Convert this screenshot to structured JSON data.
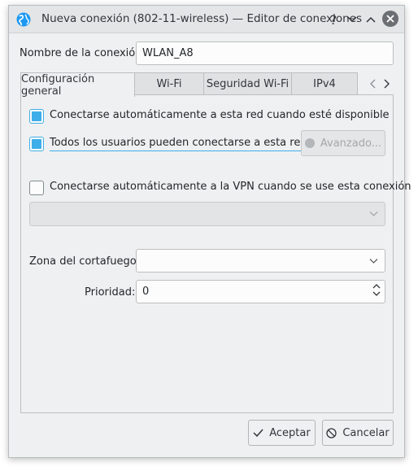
{
  "window": {
    "title": "Nueva conexión (802-11-wireless) — Editor de conexiones",
    "help_glyph": "?"
  },
  "form": {
    "connection_name_label": "Nombre de la conexión:",
    "connection_name_value": "WLAN_A8"
  },
  "tabs": [
    {
      "label": "Configuración general",
      "active": true
    },
    {
      "label": "Wi-Fi",
      "active": false
    },
    {
      "label": "Seguridad Wi-Fi",
      "active": false
    },
    {
      "label": "IPv4",
      "active": false
    }
  ],
  "general": {
    "auto_connect_label": "Conectarse automáticamente a esta red cuando esté disponible",
    "auto_connect_checked": true,
    "all_users_label": "Todos los usuarios pueden conectarse a esta red",
    "all_users_checked": true,
    "advanced_button": "Avanzado...",
    "vpn_auto_label": "Conectarse automáticamente a la VPN cuando se use esta conexión",
    "vpn_auto_checked": false,
    "vpn_select_value": "",
    "firewall_zone_label": "Zona del cortafuegos:",
    "firewall_zone_value": "",
    "priority_label": "Prioridad:",
    "priority_value": "0"
  },
  "buttons": {
    "accept": "Aceptar",
    "cancel": "Cancelar"
  },
  "colors": {
    "accent": "#3daee9",
    "window_bg": "#eff0f1",
    "close_button": "#6b6f73"
  }
}
